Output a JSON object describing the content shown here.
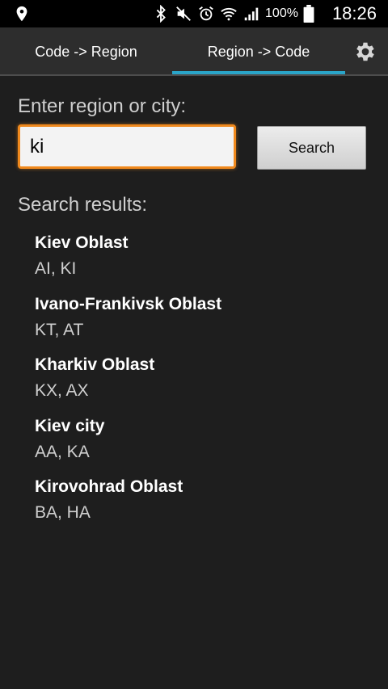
{
  "status_bar": {
    "battery_text": "100%",
    "time": "18:26",
    "icons": [
      "location-icon",
      "bluetooth-icon",
      "mute-icon",
      "alarm-icon",
      "wifi-icon",
      "signal-icon",
      "battery-icon"
    ]
  },
  "tabs": [
    {
      "label": "Code -> Region",
      "selected": false
    },
    {
      "label": "Region -> Code",
      "selected": true
    }
  ],
  "settings_icon": "gear-icon",
  "form": {
    "prompt": "Enter region or city:",
    "input_value": "ki",
    "search_label": "Search"
  },
  "results": {
    "header": "Search results:",
    "items": [
      {
        "name": "Kiev Oblast",
        "codes": "AI, KI"
      },
      {
        "name": "Ivano-Frankivsk Oblast",
        "codes": "KT, AT"
      },
      {
        "name": "Kharkiv Oblast",
        "codes": "KX, AX"
      },
      {
        "name": "Kiev city",
        "codes": "AA, KA"
      },
      {
        "name": "Kirovohrad Oblast",
        "codes": "BA, HA"
      }
    ]
  },
  "colors": {
    "accent": "#2aa5c9",
    "input_focus": "#f0891d",
    "background": "#1e1e1e"
  }
}
